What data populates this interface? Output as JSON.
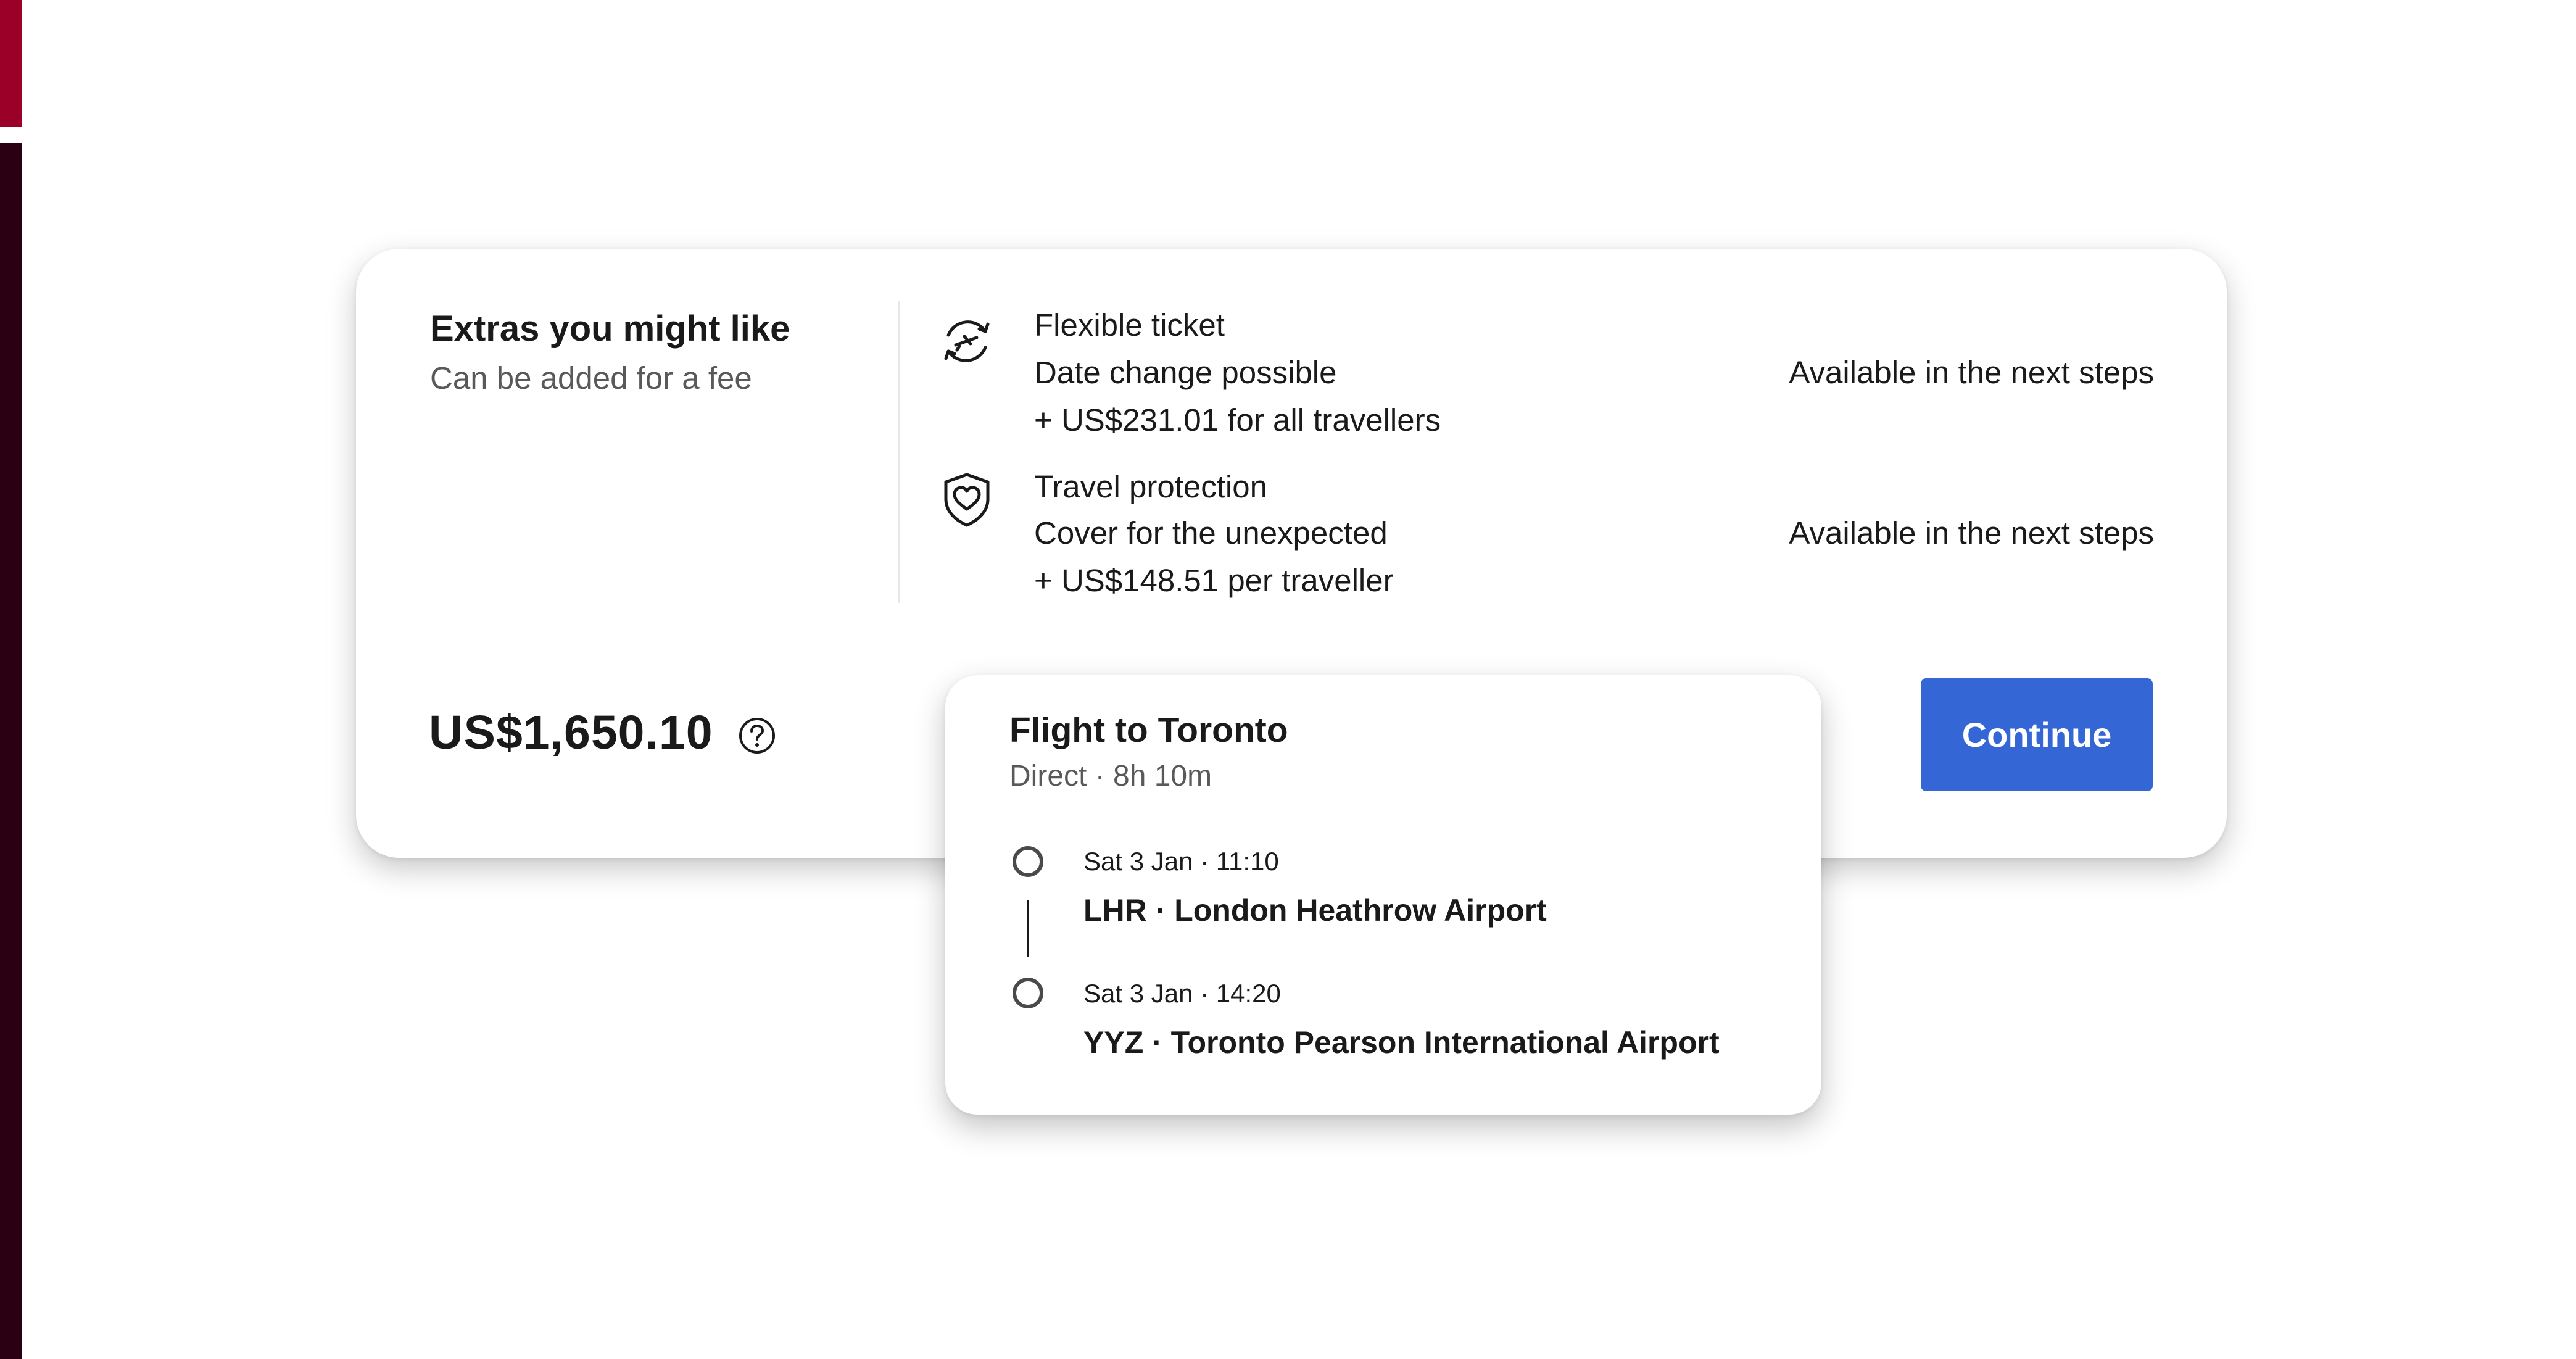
{
  "colors": {
    "accent_button": "#3566d6",
    "edge_top": "#9b0028",
    "edge_bottom": "#2c0013"
  },
  "extras": {
    "title": "Extras you might like",
    "subtitle": "Can be added for a fee",
    "items": [
      {
        "icon": "flexible-ticket-icon",
        "name": "Flexible ticket",
        "description": "Date change possible",
        "price": "+ US$231.01 for all travellers",
        "availability": "Available in the next steps"
      },
      {
        "icon": "heart-shield-icon",
        "name": "Travel protection",
        "description": "Cover for the unexpected",
        "price": "+ US$148.51 per traveller",
        "availability": "Available in the next steps"
      }
    ]
  },
  "summary": {
    "total_price": "US$1,650.10",
    "help_icon": "question-circle-icon",
    "continue_label": "Continue"
  },
  "flight_popup": {
    "title": "Flight to Toronto",
    "subtitle": "Direct · 8h 10m",
    "stops": [
      {
        "time": "Sat 3 Jan · 11:10",
        "airport": "LHR · London Heathrow Airport"
      },
      {
        "time": "Sat 3 Jan · 14:20",
        "airport": "YYZ · Toronto Pearson International Airport"
      }
    ]
  }
}
